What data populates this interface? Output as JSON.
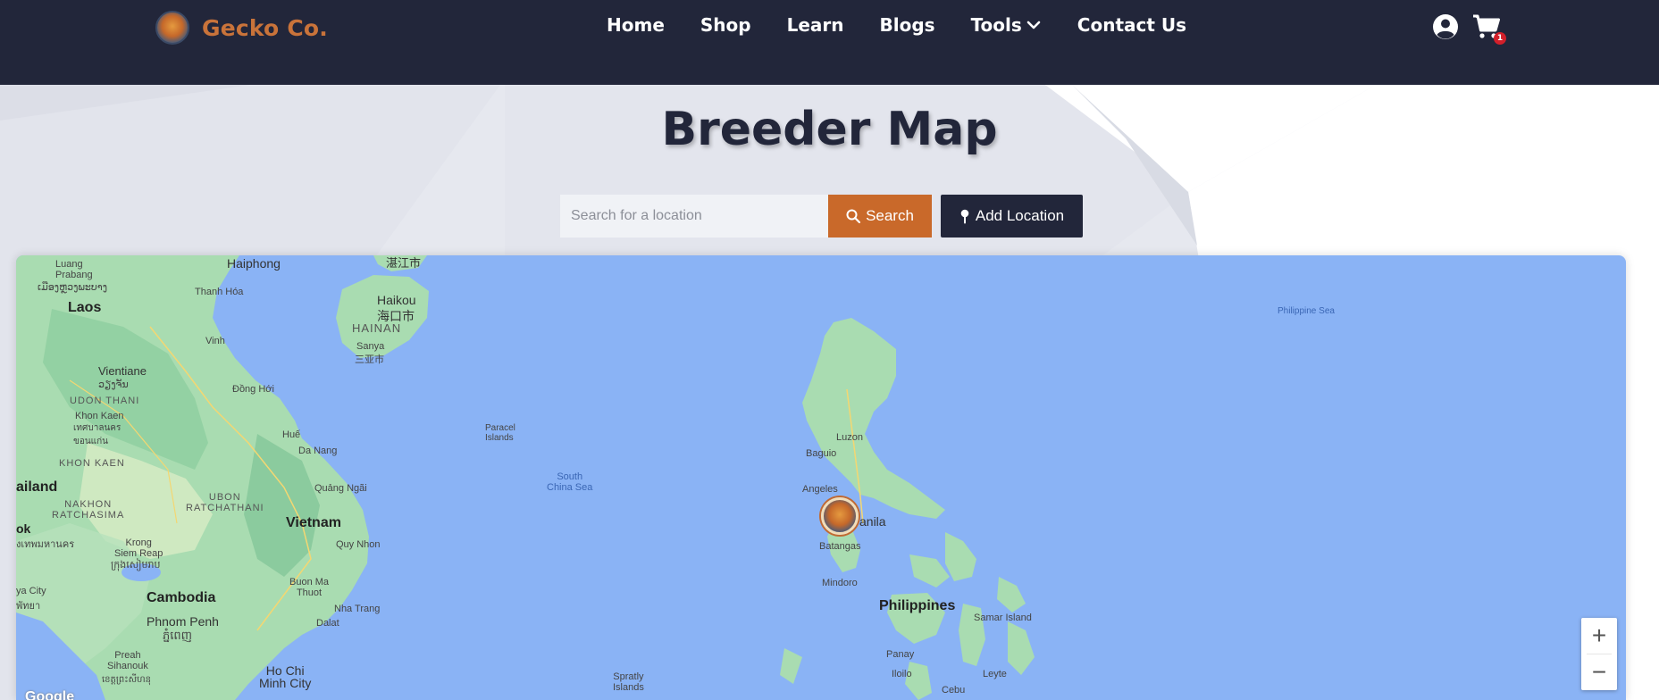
{
  "brand": {
    "name": "Gecko Co."
  },
  "nav": [
    {
      "label": "Home"
    },
    {
      "label": "Shop"
    },
    {
      "label": "Learn"
    },
    {
      "label": "Blogs"
    },
    {
      "label": "Tools"
    },
    {
      "label": "Contact Us"
    }
  ],
  "cart": {
    "count": "1"
  },
  "page": {
    "title": "Breeder Map"
  },
  "search": {
    "placeholder": "Search for a location",
    "value": "",
    "button_label": "Search",
    "add_label": "Add Location"
  },
  "map": {
    "labels": {
      "luang_prabang": "Luang\nPrabang",
      "luang_prabang_lao": "ເມືອງຫຼວງພະບາງ",
      "haiphong": "Haiphong",
      "zhanjiang": "湛江市",
      "thanh_hoa": "Thanh Hóa",
      "laos": "Laos",
      "haikou": "Haikou",
      "haikou_zh": "海口市",
      "hainan": "HAINAN",
      "sanya": "Sanya",
      "sanya_zh": "三亚市",
      "vinh": "Vinh",
      "vientiane": "Vientiane",
      "vientiane_lao": "ວຽງຈັນ",
      "udon_thani": "UDON THANI",
      "dong_hoi": "Đồng Hới",
      "khon_kaen": "Khon Kaen",
      "khon_kaen_th": "เทศบาลนคร\nขอนแก่น",
      "hue": "Huế",
      "da_nang": "Da Nang",
      "khon_kaen_region": "KHON KAEN",
      "paracel": "Paracel\nIslands",
      "south_china_sea": "South\nChina Sea",
      "ailand": "ailand",
      "quang_ngai": "Quảng Ngãi",
      "ubon": "UBON\nRATCHATHANI",
      "nakhon": "NAKHON\nRATCHASIMA",
      "ok": "ok",
      "krung_th": "ุงเทพมหานคร",
      "vietnam": "Vietnam",
      "quy_nhon": "Quy Nhon",
      "krong_siem_reap": "Krong\nSiem Reap",
      "siem_reap_km": "ក្រុងសៀមរាប",
      "buon_ma_thuot": "Buon Ma\nThuot",
      "cambodia": "Cambodia",
      "nha_trang": "Nha Trang",
      "a_city": "ya City",
      "a_city_th": "พัทยา",
      "phnom_penh": "Phnom Penh",
      "phnom_penh_km": "ភ្នំពេញ",
      "dalat": "Dalat",
      "preah": "Preah\nSihanouk",
      "preah_km": "ខេត្តព្រះសីហនុ",
      "ho_chi_minh": "Ho Chi\nMinh City",
      "spratly": "Spratly\nIslands",
      "luzon": "Luzon",
      "baguio": "Baguio",
      "angeles": "Angeles",
      "manila": "anila",
      "batangas": "Batangas",
      "mindoro": "Mindoro",
      "philippines": "Philippines",
      "samar": "Samar Island",
      "panay": "Panay",
      "iloilo": "Iloilo",
      "leyte": "Leyte",
      "cebu": "Cebu",
      "philippine_sea": "Philippine Sea",
      "google": "Google"
    }
  }
}
